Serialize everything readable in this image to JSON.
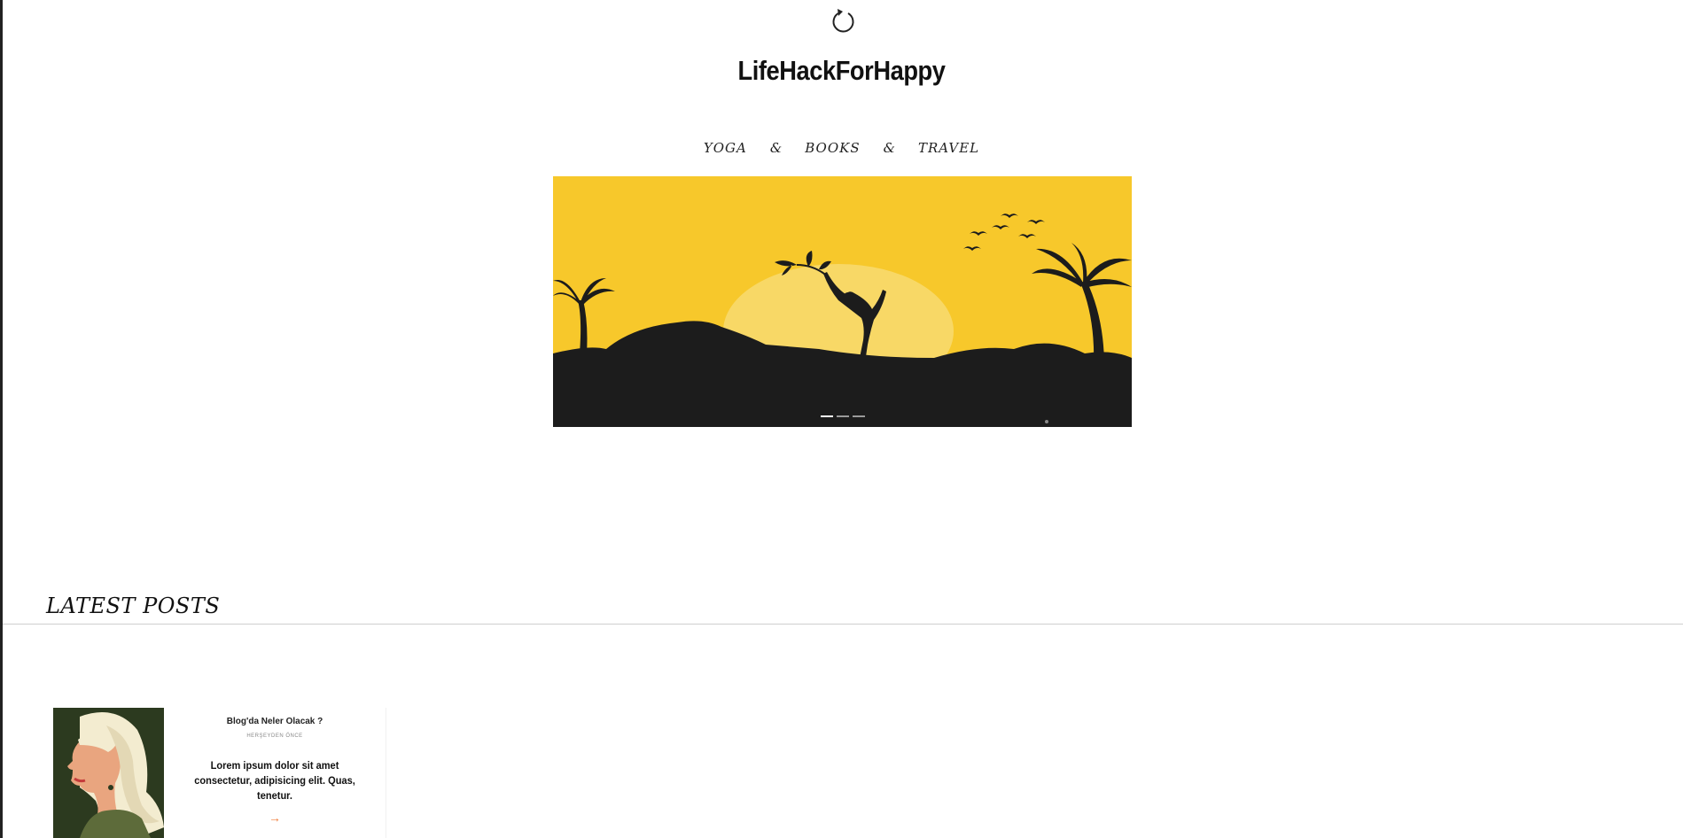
{
  "header": {
    "logo_icon": "refresh-circle-icon",
    "title": "LifeHackForHappy"
  },
  "nav": {
    "items": [
      "YOGA",
      "BOOKS",
      "TRAVEL"
    ],
    "separator": "&"
  },
  "hero": {
    "slide_count": 3,
    "active_slide": 0,
    "colors": {
      "sky": "#f7c82b",
      "sun": "#f8d866",
      "silhouette": "#1c1c1c"
    }
  },
  "latest": {
    "heading": "LATEST POSTS",
    "posts": [
      {
        "title": "Blog'da Neler Olacak ?",
        "meta": "HERŞEYDEN ÖNCE",
        "excerpt": "Lorem ipsum dolor sit amet consectetur, adipisicing elit. Quas, tenetur.",
        "arrow": "→"
      }
    ]
  },
  "colors": {
    "accent": "#f07c3a"
  }
}
